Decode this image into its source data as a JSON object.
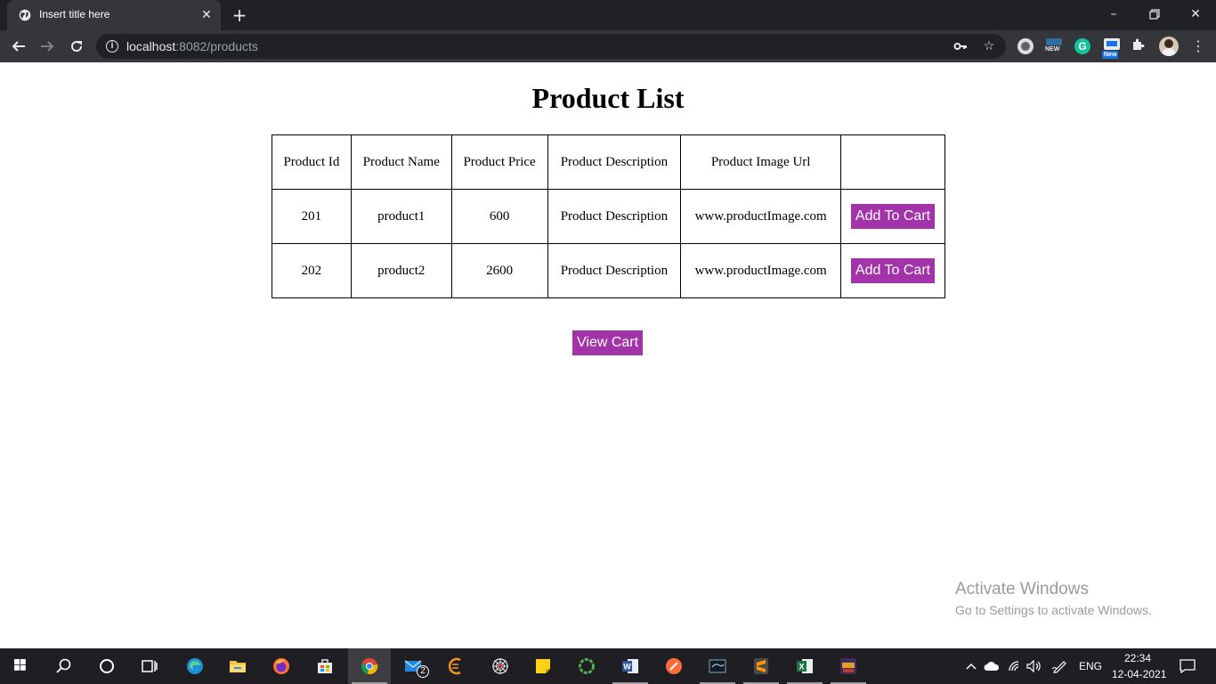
{
  "browser": {
    "tab_title": "Insert title here",
    "url_host": "localhost",
    "url_rest": ":8082/products",
    "extension_badges": {
      "new_small": "NEW",
      "new_blue": "New"
    }
  },
  "page": {
    "title": "Product List",
    "table": {
      "headers": [
        "Product Id",
        "Product Name",
        "Product Price",
        "Product Description",
        "Product Image Url",
        ""
      ],
      "rows": [
        {
          "id": "201",
          "name": "product1",
          "price": "600",
          "description": "Product Description",
          "image_url": "www.productImage.com",
          "action": "Add To Cart"
        },
        {
          "id": "202",
          "name": "product2",
          "price": "2600",
          "description": "Product Description",
          "image_url": "www.productImage.com",
          "action": "Add To Cart"
        }
      ]
    },
    "view_cart_label": "View Cart",
    "button_color": "#a333a8"
  },
  "watermark": {
    "title": "Activate Windows",
    "subtitle": "Go to Settings to activate Windows."
  },
  "taskbar": {
    "mail_badge": "2",
    "language": "ENG",
    "time": "22:34",
    "date": "12-04-2021"
  }
}
